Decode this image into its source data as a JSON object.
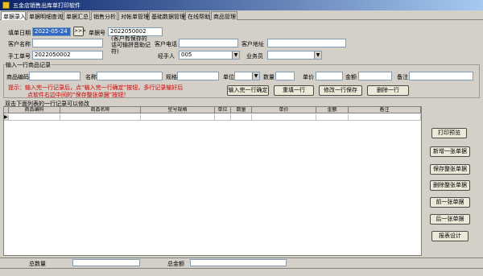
{
  "window": {
    "title": "五金店销售出库单打印软件"
  },
  "menu": [
    "单据录入",
    "单据明细查询",
    "单据汇总",
    "销售分析",
    "对帐单管理",
    "基础数据管理",
    "在线帮助",
    "商品管理"
  ],
  "form": {
    "fill_date_label": "填单日期",
    "fill_date_value": "2022-05-24",
    "date_nav": ">>>",
    "doc_no_label": "单据号",
    "doc_no_value": "2022050002",
    "customer_name_label": "客户名称",
    "customer_note": "(客户有保存的话可输拼音助记符)",
    "customer_phone_label": "客户电话",
    "customer_address_label": "客户地址",
    "manual_no_label": "手工单号",
    "manual_no_value": "2022050002",
    "handler_label": "经手人",
    "handler_value": "005",
    "salesman_label": "业务员",
    "salesman_value": ""
  },
  "entry": {
    "group_title": "输入一行商品记录",
    "code_label": "商品编码",
    "name_label": "名称",
    "spec_label": "规格",
    "unit_label": "单位",
    "qty_label": "数量",
    "price_label": "单价",
    "amount_label": "金额",
    "note_label": "备注",
    "hint_line1": "提示：输入完一行记录后，点“输入完一行确定”按钮，多行记录输好后",
    "hint_line2": "点软件右边中间的“保存整张单据”按钮！",
    "btn_confirm": "输入完一行确定",
    "btn_refill": "重填一行",
    "btn_modify_save": "修改一行保存",
    "btn_delete": "删除一行"
  },
  "grid": {
    "caption": "双击下面列表的一行记录可以修改",
    "columns": [
      "商品编码",
      "商品名称",
      "型号规格",
      "单位",
      "数量",
      "单价",
      "金额",
      "备注"
    ],
    "row_marker": "▶"
  },
  "side_buttons": {
    "print_preview": "打印预览",
    "new_doc": "新增一张单据",
    "save_doc": "保存整张单据",
    "delete_doc": "删除整张单据",
    "prev_doc": "前一张单据",
    "next_doc": "后一张单据",
    "report_design": "报表设计"
  },
  "footer": {
    "total_qty_label": "总数量",
    "total_amount_label": "总金额"
  }
}
